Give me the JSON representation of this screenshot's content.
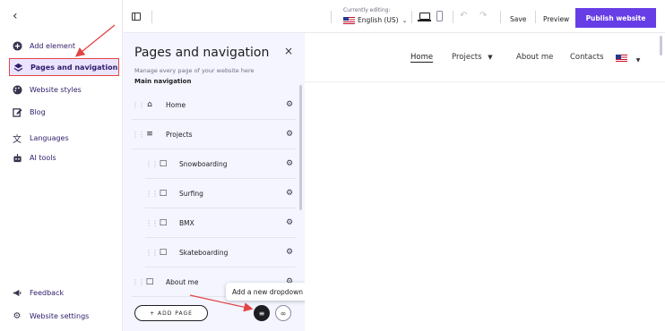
{
  "sidebar": {
    "back_icon": "chevron-left-icon",
    "items": [
      {
        "label": "Add element",
        "icon": "plus-circle-icon"
      },
      {
        "label": "Pages and navigation",
        "icon": "layers-icon",
        "active": true
      },
      {
        "label": "Website styles",
        "icon": "palette-icon"
      },
      {
        "label": "Blog",
        "icon": "edit-icon"
      },
      {
        "label": "Languages",
        "icon": "translate-icon"
      },
      {
        "label": "AI tools",
        "icon": "robot-icon"
      }
    ],
    "bottom_items": [
      {
        "label": "Feedback",
        "icon": "megaphone-icon"
      },
      {
        "label": "Website settings",
        "icon": "gear-icon"
      }
    ]
  },
  "panel": {
    "title": "Pages and navigation",
    "subtitle": "Manage every page of your website here",
    "section_label": "Main navigation",
    "pages": [
      {
        "label": "Home",
        "icon": "home-icon",
        "level": 0
      },
      {
        "label": "Projects",
        "icon": "dropdown-list-icon",
        "level": 0
      },
      {
        "label": "Snowboarding",
        "icon": "page-icon",
        "level": 1
      },
      {
        "label": "Surfing",
        "icon": "page-icon",
        "level": 1
      },
      {
        "label": "BMX",
        "icon": "page-icon",
        "level": 1
      },
      {
        "label": "Skateboarding",
        "icon": "page-icon",
        "level": 1
      },
      {
        "label": "About me",
        "icon": "page-icon",
        "level": 0
      }
    ],
    "add_page_label": "+ ADD PAGE",
    "tooltip": "Add a new dropdown"
  },
  "toolbar": {
    "editing_label": "Currently editing:",
    "language": "English (US)",
    "save_label": "Save",
    "preview_label": "Preview",
    "publish_label": "Publish website",
    "accent_color": "#673de6"
  },
  "site_nav": {
    "links": [
      "Home",
      "Projects",
      "About me",
      "Contacts"
    ],
    "current": "Home"
  },
  "colors": {
    "active_bg": "#ebe4ff",
    "annotation_red": "#e24545",
    "panel_bg": "#f4f5ff"
  }
}
